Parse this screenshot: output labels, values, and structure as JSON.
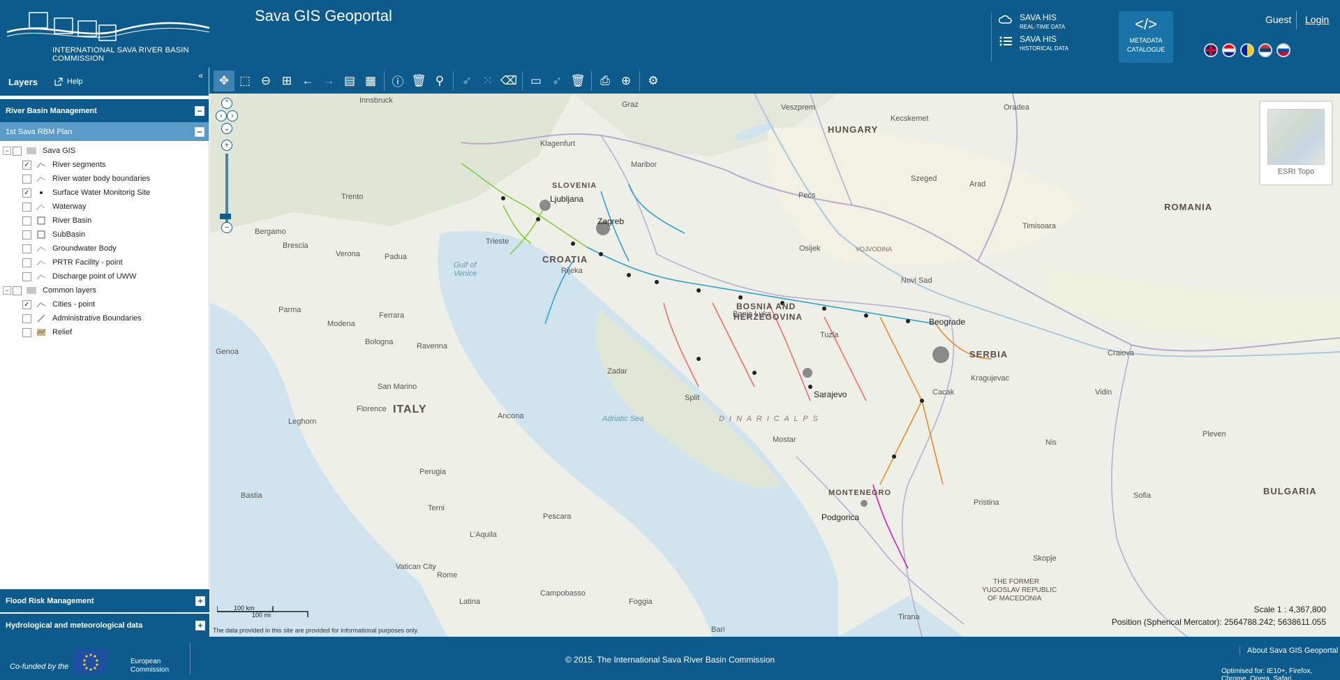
{
  "header": {
    "org_name": "INTERNATIONAL SAVA RIVER BASIN COMMISSION",
    "app_title": "Sava GIS Geoportal",
    "his_realtime_title": "SAVA HIS",
    "his_realtime_sub": "REAL-TIME DATA",
    "his_hist_title": "SAVA HIS",
    "his_hist_sub": "HISTORICAL DATA",
    "metadata_l1": "METADATA",
    "metadata_l2": "CATALOGUE",
    "guest": "Guest",
    "login": "Login"
  },
  "sidebar": {
    "layers_label": "Layers",
    "help_label": "Help",
    "section_rbm": "River Basin Management",
    "sub_plan": "1st Sava RBM Plan",
    "tree": [
      {
        "label": "Sava GIS",
        "checked": false,
        "type": "group"
      },
      {
        "label": "River segments",
        "checked": true,
        "type": "layer"
      },
      {
        "label": "River water body boundaries",
        "checked": false,
        "type": "layer"
      },
      {
        "label": "Surface Water Monitorig Site",
        "checked": true,
        "type": "layer"
      },
      {
        "label": "Waterway",
        "checked": false,
        "type": "layer"
      },
      {
        "label": "River Basin",
        "checked": false,
        "type": "layer"
      },
      {
        "label": "SubBasin",
        "checked": false,
        "type": "layer"
      },
      {
        "label": "Groundwater Body",
        "checked": false,
        "type": "layer"
      },
      {
        "label": "PRTR Facility - point",
        "checked": false,
        "type": "layer"
      },
      {
        "label": "Discharge point of UWW",
        "checked": false,
        "type": "layer"
      },
      {
        "label": "Common layers",
        "checked": false,
        "type": "group"
      },
      {
        "label": "Cities - point",
        "checked": true,
        "type": "layer"
      },
      {
        "label": "Administrative Boundaries",
        "checked": false,
        "type": "layer"
      },
      {
        "label": "Relief",
        "checked": false,
        "type": "layer"
      }
    ],
    "section_flood": "Flood Risk Management",
    "section_hydro": "Hydrological and meteorological data"
  },
  "map": {
    "basemap_name": "ESRI Topo",
    "scale_km": "100 km",
    "scale_mi": "100 mi",
    "disclaimer": "The data provided in this site are provided for informational purposes only.",
    "scale_ratio": "Scale 1 : 4,367,800",
    "position": "Position (Spherical Mercator): 2564788.242; 5638611.055",
    "labels": {
      "hungary": "HUNGARY",
      "romania": "ROMANIA",
      "slovenia": "SLOVENIA",
      "croatia": "CROATIA",
      "bosnia1": "BOSNIA AND",
      "bosnia2": "HERZEGOVINA",
      "serbia": "SERBIA",
      "montenegro": "MONTENEGRO",
      "bulgaria": "BULGARIA",
      "italy": "ITALY",
      "macedonia1": "THE FORMER",
      "macedonia2": "YUGOSLAV REPUBLIC",
      "macedonia3": "OF MACEDONIA",
      "adriatic": "Adriatic Sea",
      "gulf1": "Gulf of",
      "gulf2": "Venice",
      "dinaric": "D I N A R I C   A L P S",
      "vojvodina": "VOJVODINA",
      "zagreb": "Zagreb",
      "ljubljana": "Ljubljana",
      "sarajevo": "Sarajevo",
      "belgrade": "Beograde",
      "podgorica": "Podgorica",
      "banja_luka": "Banja Luka",
      "tuzla": "Tuzla",
      "novi_sad": "Novi Sad",
      "osijek": "Osijek",
      "split": "Split",
      "zadar": "Zadar",
      "rijeka": "Rijeka",
      "trieste": "Trieste",
      "graz": "Graz",
      "pecs": "Pecs",
      "szeged": "Szeged",
      "timisoara": "Timisoara",
      "sofia": "Sofia",
      "skopje": "Skopje",
      "tirana": "Tirana",
      "pristina": "Pristina",
      "nis": "Nis",
      "rome": "Rome",
      "venice": "Venice",
      "bologna": "Bologna",
      "florence": "Florence",
      "ancona": "Ancona",
      "pescara": "Pescara",
      "mostar": "Mostar",
      "kragujevac": "Kragujevac",
      "cacak": "Cacak",
      "vidin": "Vidin",
      "craiova": "Craiova",
      "pleven": "Pleven",
      "arad": "Arad",
      "oradea": "Oradea",
      "kecskemet": "Kecskemet",
      "veszprem": "Veszprem",
      "maribor": "Maribor",
      "klagenfurt": "Klagenfurt",
      "bari": "Bari",
      "foggia": "Foggia",
      "latina": "Latina",
      "vatican": "Vatican City",
      "padua": "Padua",
      "verona": "Verona",
      "brescia": "Brescia",
      "bergamo": "Bergamo",
      "trento": "Trento",
      "innsbruck": "Innsbruck",
      "parma": "Parma",
      "modena": "Modena",
      "ferrara": "Ferrara",
      "ravenna": "Ravenna",
      "san_marino": "San Marino",
      "perugia": "Perugia",
      "terni": "Terni",
      "laquila": "L'Aquila",
      "genoa": "Genoa",
      "bastia": "Bastia",
      "leghorn": "Leghorn",
      "campobasso": "Campobasso"
    }
  },
  "footer": {
    "cofund": "Co-funded by the",
    "eu_l1": "European",
    "eu_l2": "Commission",
    "copyright": "© 2015. The International Sava River Basin Commission",
    "about": "About Sava GIS Geoportal",
    "optimised": "Optimised for: IE10+, Firefox, Chrome, Opera, Safari"
  }
}
